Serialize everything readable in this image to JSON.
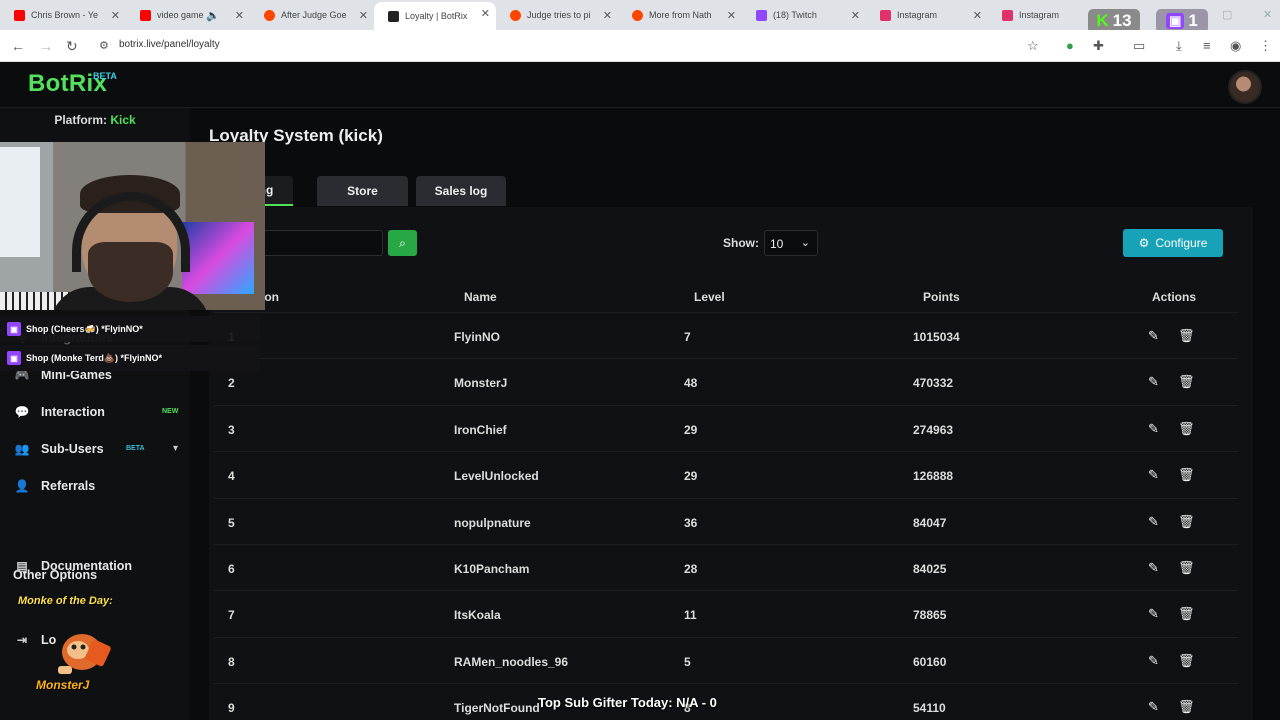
{
  "browser": {
    "tabs": [
      {
        "label": "Chris Brown - Ye",
        "color": "#ff0000"
      },
      {
        "label": "video game",
        "color": "#ff0000"
      },
      {
        "label": "After Judge Goe",
        "color": "#ff4500"
      },
      {
        "label": "Loyalty | BotRix",
        "color": "#222222"
      },
      {
        "label": "Judge tries to pi",
        "color": "#ff4500"
      },
      {
        "label": "More from Nath",
        "color": "#ff4500"
      },
      {
        "label": "(18) Twitch",
        "color": "#9146ff"
      },
      {
        "label": "Instagram",
        "color": "#e1306c"
      },
      {
        "label": "Instagram",
        "color": "#e1306c"
      }
    ],
    "kick_count": "13",
    "twitch_count": "1",
    "url": "botrix.live/panel/loyalty"
  },
  "app": {
    "logo": "BotRix",
    "logo_badge": "BETA",
    "platform_label": "Platform:",
    "platform_value": "Kick"
  },
  "sidebar": {
    "items": [
      {
        "label": "Integrations",
        "icon": "puzzle-icon"
      },
      {
        "label": "Mini-Games",
        "icon": "gamepad-icon"
      },
      {
        "label": "Interaction",
        "icon": "chat-icon",
        "badge": "NEW"
      },
      {
        "label": "Sub-Users",
        "icon": "users-icon",
        "badge": "BETA"
      },
      {
        "label": "Referrals",
        "icon": "referrals-icon"
      }
    ],
    "other_options": "Other Options",
    "other_items": [
      {
        "label": "Documentation",
        "icon": "book-icon"
      },
      {
        "label": "Lo",
        "icon": "logout-icon"
      }
    ]
  },
  "main": {
    "title": "Loyalty System (kick)",
    "tabs": [
      "king",
      "Store",
      "Sales log"
    ],
    "search_placeholder": "rch...",
    "show_label": "Show:",
    "show_value": "10",
    "configure_label": "Configure",
    "columns": [
      "ion",
      "Name",
      "Level",
      "Points",
      "Actions"
    ],
    "rows": [
      {
        "rank": "1",
        "name": "FlyinNO",
        "level": "7",
        "points": "1015034"
      },
      {
        "rank": "2",
        "name": "MonsterJ",
        "level": "48",
        "points": "470332"
      },
      {
        "rank": "3",
        "name": "IronChief",
        "level": "29",
        "points": "274963"
      },
      {
        "rank": "4",
        "name": "LevelUnlocked",
        "level": "29",
        "points": "126888"
      },
      {
        "rank": "5",
        "name": "nopulpnature",
        "level": "36",
        "points": "84047"
      },
      {
        "rank": "6",
        "name": "K10Pancham",
        "level": "28",
        "points": "84025"
      },
      {
        "rank": "7",
        "name": "ItsKoala",
        "level": "11",
        "points": "78865"
      },
      {
        "rank": "8",
        "name": "RAMen_noodles_96",
        "level": "5",
        "points": "60160"
      },
      {
        "rank": "9",
        "name": "TigerNotFound",
        "level": "8",
        "points": "54110"
      }
    ]
  },
  "overlay": {
    "alerts": [
      "Shop (Cheers🍻) *FlyinNO*",
      "Shop (Monke Terd💩) *FlyinNO*"
    ],
    "monke_title": "Monke of the Day:",
    "monke_name": "MonsterJ",
    "ticker": "Top Sub Gifter Today: N/A - 0"
  }
}
